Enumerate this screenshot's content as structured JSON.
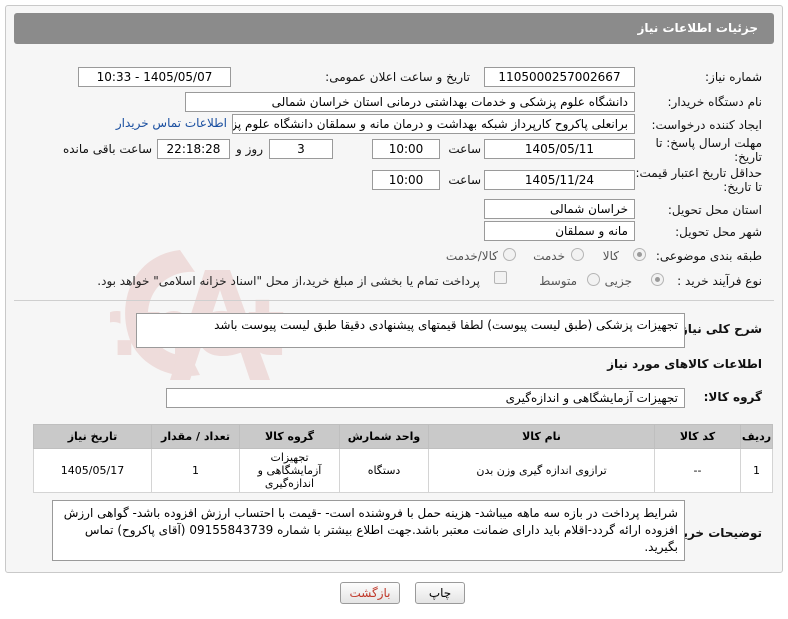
{
  "header": {
    "title": "جزئیات اطلاعات نیاز"
  },
  "fields": {
    "need_number": {
      "label": "شماره نیاز:",
      "value": "1105000257002667"
    },
    "announce_datetime": {
      "label": "تاریخ و ساعت اعلان عمومی:",
      "value": "1405/05/07 - 10:33"
    },
    "buyer_org": {
      "label": "نام دستگاه خریدار:",
      "value": "دانشگاه علوم پزشکی و خدمات بهداشتی درمانی استان خراسان شمالی"
    },
    "requester": {
      "label": "ایجاد کننده درخواست:",
      "value": "برانعلی پاکروح کارپرداز شبکه بهداشت و درمان مانه و سملقان دانشگاه علوم پزشکی",
      "contact_link": "اطلاعات تماس خریدار"
    },
    "reply_deadline": {
      "label": "مهلت ارسال پاسخ: تا تاریخ:",
      "date": "1405/05/11",
      "time_label": "ساعت",
      "time": "10:00",
      "days": "3",
      "days_label": "روز و",
      "remaining": "22:18:28",
      "remaining_label": "ساعت باقی مانده"
    },
    "price_validity": {
      "label": "حداقل تاریخ اعتبار قیمت: تا تاریخ:",
      "date": "1405/11/24",
      "time_label": "ساعت",
      "time": "10:00"
    },
    "delivery_province": {
      "label": "استان محل تحویل:",
      "value": "خراسان شمالی"
    },
    "delivery_city": {
      "label": "شهر محل تحویل:",
      "value": "مانه و سملقان"
    },
    "category": {
      "label": "طبقه بندی موضوعی:",
      "options": [
        "کالا",
        "خدمت",
        "کالا/خدمت"
      ],
      "selected": "کالا"
    },
    "purchase_process": {
      "label": "نوع فرآیند خرید :",
      "options": [
        "جزیی",
        "متوسط"
      ],
      "selected": "جزیی",
      "partial_payment": "پرداخت تمام یا بخشی از مبلغ خرید،از محل \"اسناد خزانه اسلامی\" خواهد بود."
    }
  },
  "general_description": {
    "label": "شرح کلی نیاز:",
    "value": "تجهیزات پزشکی (طبق لیست پیوست) لطفا قیمتهای پیشنهادی دقیقا طبق لیست پیوست باشد"
  },
  "goods_info": {
    "title": "اطلاعات کالاهای مورد نیاز",
    "group_label": "گروه کالا:",
    "group_value": "تجهیزات آزمایشگاهی و اندازه‌گیری"
  },
  "table": {
    "headers": [
      "ردیف",
      "کد کالا",
      "نام کالا",
      "واحد شمارش",
      "گروه کالا",
      "تعداد / مقدار",
      "تاریخ نیاز"
    ],
    "rows": [
      {
        "row": "1",
        "code": "--",
        "name": "ترازوی اندازه گیری وزن بدن",
        "unit": "دستگاه",
        "group": "تجهیزات آزمایشگاهی و اندازه‌گیری",
        "qty": "1",
        "date": "1405/05/17"
      }
    ]
  },
  "buyer_notes": {
    "label": "توضیحات خریدار:",
    "value": "شرایط پرداخت در بازه سه ماهه میباشد- هزینه حمل با فروشنده است- -قیمت با احتساب ارزش افزوده  باشد- گواهی ارزش افزوده ارائه گردد-اقلام باید دارای ضمانت معتبر باشد.جهت اطلاع بیشتر با شماره 09155843739 (آقای پاکروح) تماس بگیرید."
  },
  "buttons": {
    "print": "چاپ",
    "back": "بازگشت"
  },
  "watermark_text": "AriaTender.net",
  "colors": {
    "header_bg": "#8b8b8b",
    "link": "#1a4fa0",
    "back_text": "#c0392b"
  }
}
